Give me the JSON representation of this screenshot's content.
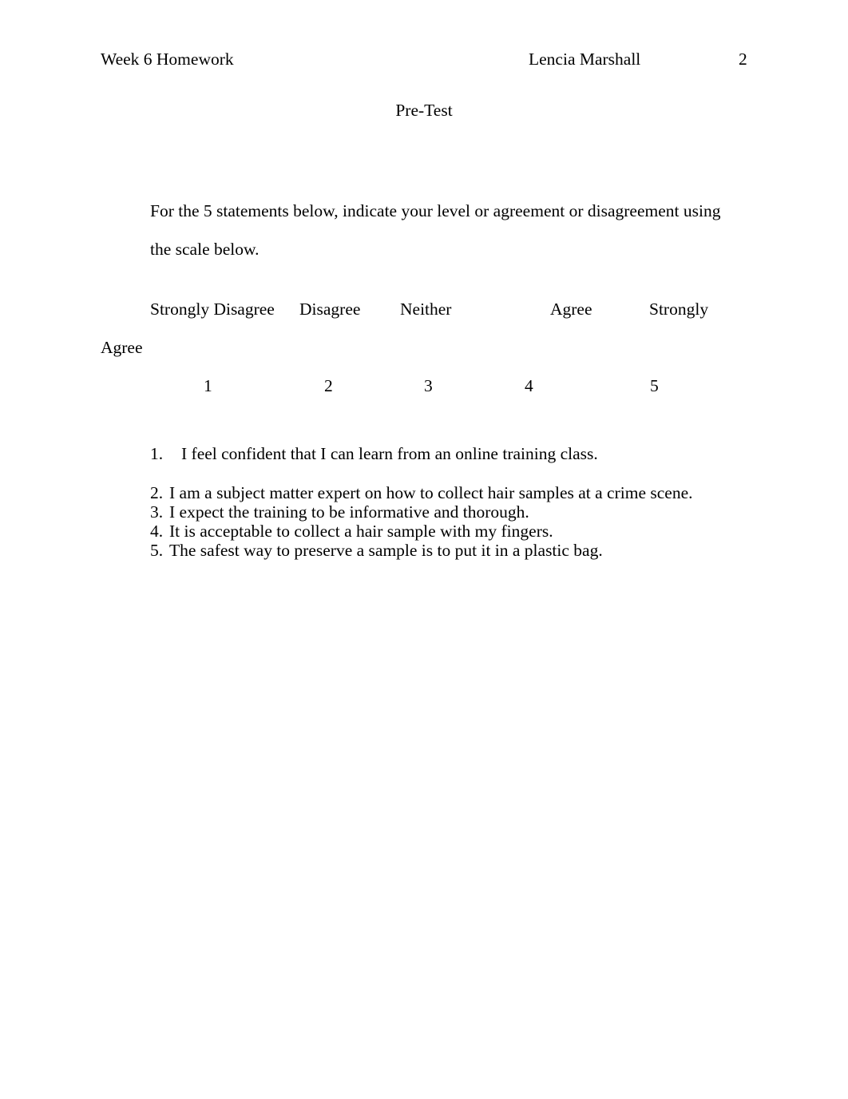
{
  "document": {
    "header": {
      "left": "Week 6 Homework",
      "center": "Lencia Marshall",
      "page_number": "2"
    },
    "title": "Pre-Test",
    "intro": "For the 5 statements below, indicate your level or agreement or disagreement using the scale below.",
    "scale": {
      "labels": [
        "Strongly Disagree",
        "Disagree",
        "Neither",
        "Agree",
        "Strongly"
      ],
      "label_wrap": "Agree",
      "numbers": [
        "1",
        "2",
        "3",
        "4",
        "5"
      ]
    },
    "statements": [
      {
        "number": "1.",
        "text": "I feel confident that I can learn from an online training class."
      },
      {
        "number": "2.",
        "text": "I am a subject matter expert on how to collect hair samples at a crime scene."
      },
      {
        "number": "3.",
        "text": "I expect the training to be informative and thorough."
      },
      {
        "number": "4.",
        "text": "It is acceptable to collect a hair sample with my fingers."
      },
      {
        "number": "5.",
        "text": "The safest way to preserve a sample is to put it in a plastic bag."
      }
    ]
  },
  "colors": {
    "page_background": "#ffffff",
    "text": "#000000"
  }
}
